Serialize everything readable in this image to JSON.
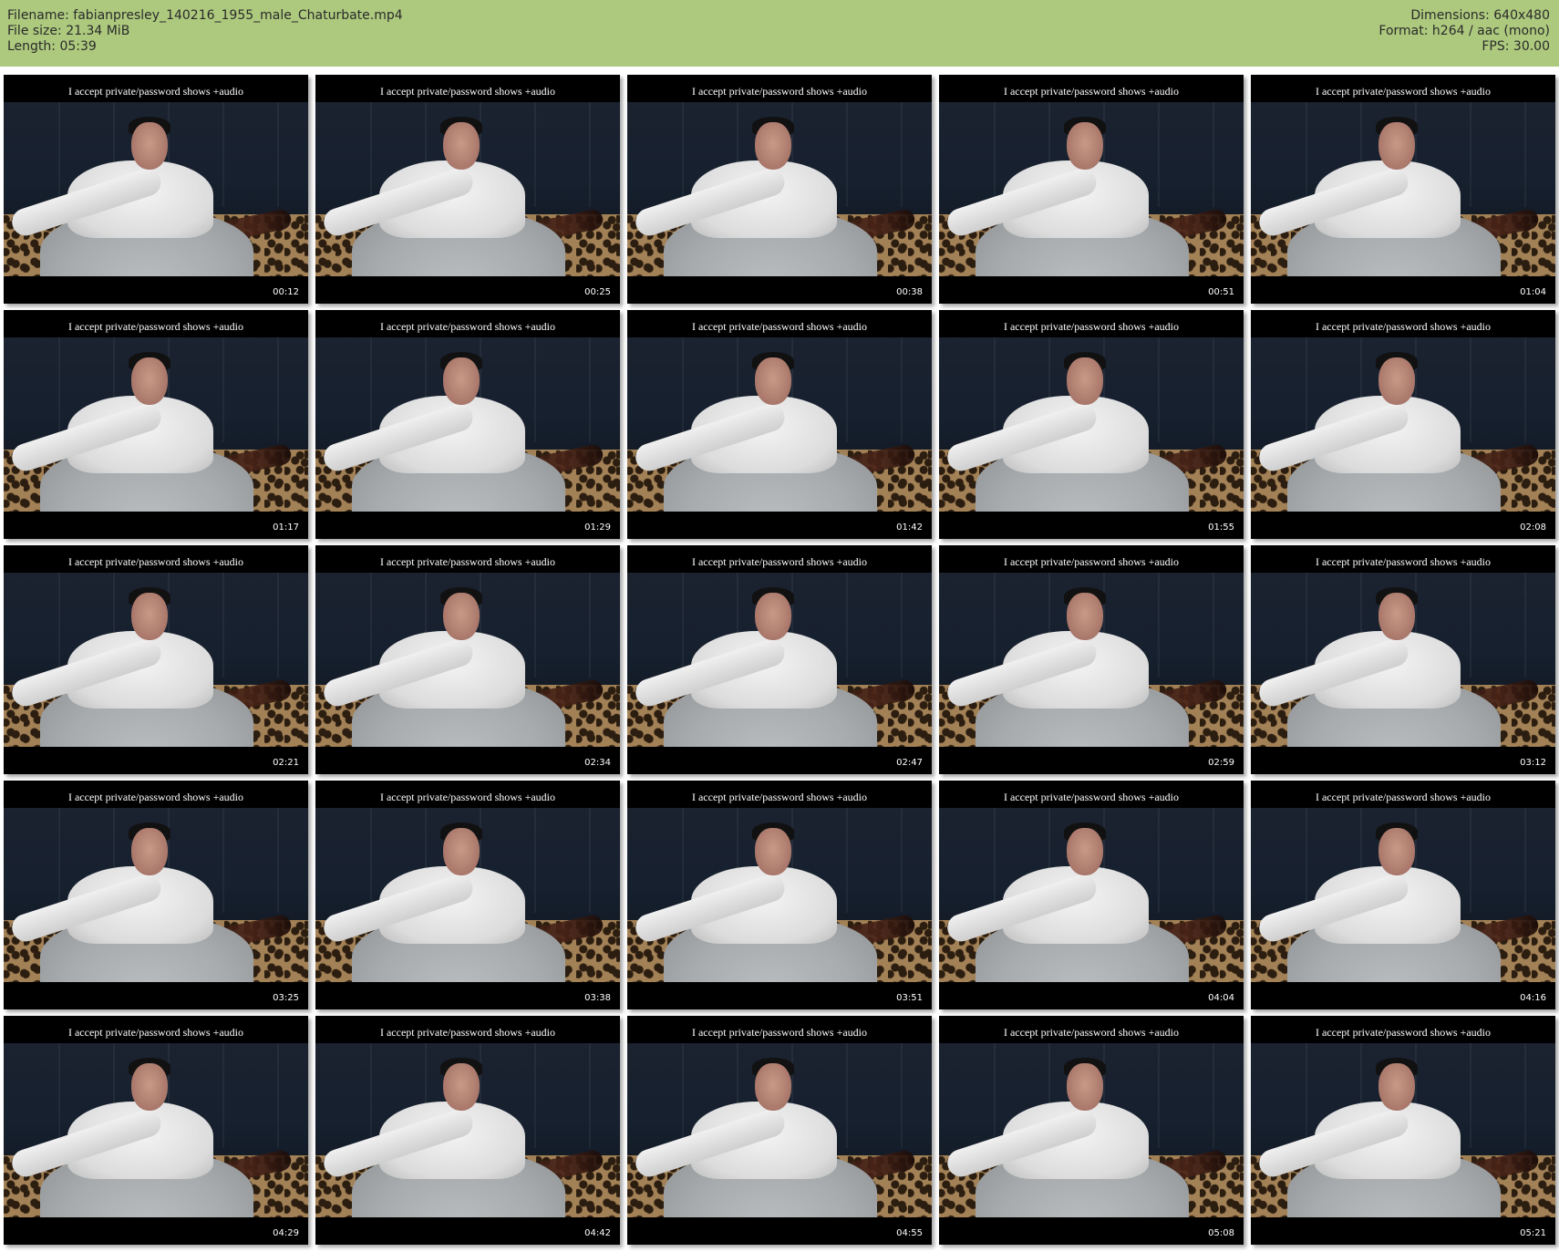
{
  "header": {
    "filename_line": "Filename: fabianpresley_140216_1955_male_Chaturbate.mp4",
    "filesize_line": "File size: 21.34 MiB",
    "length_line": "Length: 05:39",
    "dimensions_line": "Dimensions: 640x480",
    "format_line": "Format: h264 / aac (mono)",
    "fps_line": "FPS: 30.00",
    "background_color": "#adc97e"
  },
  "thumbnail_caption": "I accept private/password shows +audio",
  "thumbnails": [
    {
      "caption": "I accept private/password shows +audio",
      "timestamp": "00:12"
    },
    {
      "caption": "I accept private/password shows +audio",
      "timestamp": "00:25"
    },
    {
      "caption": "I accept private/password shows +audio",
      "timestamp": "00:38"
    },
    {
      "caption": "I accept private/password shows +audio",
      "timestamp": "00:51"
    },
    {
      "caption": "I accept private/password shows +audio",
      "timestamp": "01:04"
    },
    {
      "caption": "I accept private/password shows +audio",
      "timestamp": "01:17"
    },
    {
      "caption": "I accept private/password shows +audio",
      "timestamp": "01:29"
    },
    {
      "caption": "I accept private/password shows +audio",
      "timestamp": "01:42"
    },
    {
      "caption": "I accept private/password shows +audio",
      "timestamp": "01:55"
    },
    {
      "caption": "I accept private/password shows +audio",
      "timestamp": "02:08"
    },
    {
      "caption": "I accept private/password shows +audio",
      "timestamp": "02:21"
    },
    {
      "caption": "I accept private/password shows +audio",
      "timestamp": "02:34"
    },
    {
      "caption": "I accept private/password shows +audio",
      "timestamp": "02:47"
    },
    {
      "caption": "I accept private/password shows +audio",
      "timestamp": "02:59"
    },
    {
      "caption": "I accept private/password shows +audio",
      "timestamp": "03:12"
    },
    {
      "caption": "I accept private/password shows +audio",
      "timestamp": "03:25"
    },
    {
      "caption": "I accept private/password shows +audio",
      "timestamp": "03:38"
    },
    {
      "caption": "I accept private/password shows +audio",
      "timestamp": "03:51"
    },
    {
      "caption": "I accept private/password shows +audio",
      "timestamp": "04:04"
    },
    {
      "caption": "I accept private/password shows +audio",
      "timestamp": "04:16"
    },
    {
      "caption": "I accept private/password shows +audio",
      "timestamp": "04:29"
    },
    {
      "caption": "I accept private/password shows +audio",
      "timestamp": "04:42"
    },
    {
      "caption": "I accept private/password shows +audio",
      "timestamp": "04:55"
    },
    {
      "caption": "I accept private/password shows +audio",
      "timestamp": "05:08"
    },
    {
      "caption": "I accept private/password shows +audio",
      "timestamp": "05:21"
    }
  ]
}
